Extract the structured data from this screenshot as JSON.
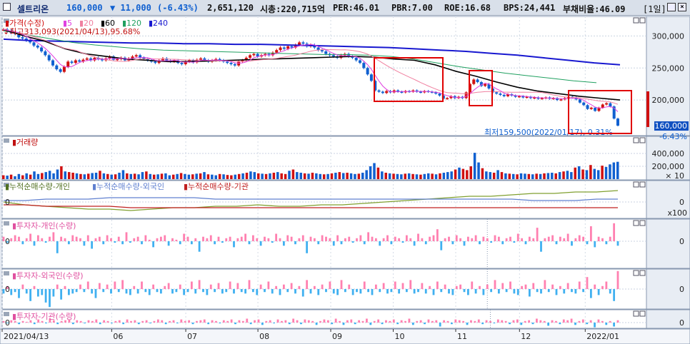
{
  "header": {
    "name": "셀트리온",
    "price": "160,000",
    "change": "▼ 11,000",
    "change_pct": "(-6.43%)",
    "volume": "2,651,120",
    "market_cap": "시총:220,715억",
    "per": "PER:46.01",
    "pbr": "PBR:7.00",
    "roe": "ROE:16.68",
    "bps": "BPS:24,441",
    "debt": "부채비율:46.09",
    "period": "[1일]"
  },
  "colors": {
    "up": "#d01010",
    "down": "#1060d0",
    "ma5": "#e040e0",
    "ma20": "#f080a0",
    "ma60": "#000000",
    "ma120": "#20a060",
    "ma240": "#1818d0",
    "inv_personal": "#80a030",
    "inv_foreign": "#6080d0",
    "inv_inst": "#c02020",
    "bar_pos": "#ff80b0",
    "bar_neg": "#40b0f0",
    "highlight": "#e00000"
  },
  "chart_data": [
    {
      "type": "line",
      "panel": "price",
      "legend_prefix": "가격(수정)",
      "legend": [
        "5",
        "20",
        "60",
        "120",
        "240"
      ],
      "annotation_high": "최고313,093(2021/04/13),95.68%",
      "annotation_low": "최저159,500(2022/01/17), 0.31%",
      "current_price": 160000,
      "current_price_label": "160,000",
      "current_change_label": "-6.43%",
      "x_ticks": [
        "2021/04/13",
        "06",
        "07",
        "08",
        "09",
        "10",
        "11",
        "12",
        "2022/01"
      ],
      "y_ticks": [
        300000,
        250000,
        200000
      ],
      "y_tick_labels": [
        "300,000",
        "250,000",
        "200,000"
      ],
      "ylim": [
        150000,
        325000
      ],
      "close": [
        310000,
        308000,
        305000,
        304000,
        298000,
        296000,
        293000,
        290000,
        285000,
        282000,
        276000,
        270000,
        262000,
        254000,
        248000,
        244000,
        252000,
        260000,
        258000,
        262000,
        260000,
        263000,
        265000,
        262000,
        266000,
        264000,
        262000,
        265000,
        268000,
        263000,
        264000,
        266000,
        262000,
        265000,
        268000,
        270000,
        266000,
        264000,
        262000,
        260000,
        258000,
        262000,
        265000,
        262000,
        260000,
        262000,
        258000,
        256000,
        260000,
        262000,
        259000,
        263000,
        265000,
        262000,
        260000,
        262000,
        264000,
        262000,
        260000,
        258000,
        256000,
        254000,
        260000,
        262000,
        266000,
        270000,
        272000,
        268000,
        270000,
        272000,
        270000,
        274000,
        278000,
        282000,
        280000,
        284000,
        282000,
        286000,
        290000,
        288000,
        284000,
        286000,
        282000,
        278000,
        276000,
        272000,
        270000,
        268000,
        266000,
        270000,
        272000,
        268000,
        266000,
        262000,
        258000,
        250000,
        240000,
        230000,
        215000,
        213000,
        211000,
        214000,
        212000,
        215000,
        213000,
        212000,
        214000,
        213000,
        215000,
        213000,
        212000,
        214000,
        213000,
        212000,
        210000,
        207000,
        202000,
        203000,
        206000,
        203000,
        205000,
        203000,
        212000,
        225000,
        232000,
        228000,
        222000,
        225000,
        218000,
        212000,
        210000,
        208000,
        206000,
        209000,
        207000,
        205000,
        206000,
        204000,
        205000,
        203000,
        204000,
        202000,
        203000,
        204000,
        202000,
        203000,
        200000,
        201000,
        203000,
        205000,
        204000,
        201000,
        196000,
        192000,
        186000,
        188000,
        183000,
        188000,
        193000,
        195000,
        190000,
        171000,
        160000
      ],
      "ma60": [
        310000,
        300000,
        292000,
        280000,
        272000,
        268000,
        264000,
        262000,
        260000,
        260000,
        261000,
        262000,
        263000,
        264000,
        265000,
        266000,
        267000,
        268000,
        267000,
        264000,
        262000,
        255000,
        245000,
        237000,
        228000,
        220000,
        214000,
        210000,
        206000,
        203000,
        200000
      ],
      "ma120": [
        308000,
        302000,
        296000,
        290000,
        286000,
        283000,
        280000,
        278000,
        277000,
        276000,
        275000,
        274000,
        273000,
        272000,
        271000,
        271000,
        270000,
        268000,
        264000,
        258000,
        252000,
        247000,
        242000,
        238000,
        234000,
        230000,
        227000
      ],
      "ma240": [
        295000,
        293000,
        292000,
        291000,
        290000,
        289000,
        289000,
        288000,
        288000,
        287000,
        287000,
        286000,
        285000,
        284000,
        283000,
        282000,
        280000,
        278000,
        276000,
        273000,
        270000,
        266000,
        262000,
        258000,
        255000
      ]
    },
    {
      "type": "bar",
      "panel": "volume",
      "title": "거래량",
      "y_ticks": [
        400000,
        200000
      ],
      "y_tick_labels": [
        "400,000",
        "200,000"
      ],
      "unit_label": "× 10",
      "ylim": [
        0,
        500000
      ],
      "values": [
        60,
        55,
        70,
        45,
        80,
        60,
        90,
        70,
        120,
        80,
        95,
        110,
        130,
        90,
        150,
        200,
        120,
        110,
        100,
        90,
        80,
        75,
        85,
        95,
        100,
        130,
        90,
        80,
        70,
        75,
        100,
        140,
        90,
        80,
        85,
        75,
        110,
        120,
        80,
        70,
        75,
        85,
        90,
        60,
        70,
        80,
        95,
        80,
        70,
        75,
        85,
        90,
        110,
        75,
        70,
        60,
        80,
        75,
        65,
        60,
        70,
        80,
        90,
        100,
        120,
        110,
        90,
        85,
        80,
        90,
        100,
        110,
        90,
        80,
        130,
        150,
        110,
        100,
        90,
        85,
        100,
        90,
        80,
        75,
        80,
        90,
        100,
        110,
        95,
        100,
        90,
        80,
        85,
        100,
        140,
        200,
        250,
        180,
        120,
        100,
        90,
        85,
        80,
        75,
        85,
        90,
        80,
        75,
        70,
        80,
        90,
        85,
        75,
        90,
        100,
        110,
        120,
        150,
        180,
        160,
        140,
        200,
        410,
        260,
        170,
        120,
        110,
        100,
        140,
        110,
        90,
        85,
        80,
        75,
        90,
        85,
        80,
        75,
        85,
        80,
        90,
        95,
        100,
        90,
        110,
        120,
        130,
        110,
        180,
        200,
        150,
        140,
        220,
        160,
        140,
        210,
        190,
        230,
        260,
        270
      ],
      "directions": "UDUDDUDUDDUDDDDUDUUDUDUDDUDUDUDDUDUDDUDUDUDDUDUDDUDUDUDDUDUUDUDUDDUDUDUDUUDUDDUDUDDUDUDUDUDDUDDDDUDUDUDDUDUDUDDUDUDDDUDUUUDDUDDUDUDUDUDDUDUDUDDUDUDDUDUDUDDUDDD"
    },
    {
      "type": "line",
      "panel": "cumulative_net_buying",
      "series": [
        {
          "name": "누적순매수량-개인",
          "values": [
            0,
            -2,
            -3,
            -4,
            -5,
            -5,
            -6,
            -5,
            -4,
            -4,
            -3,
            -3,
            -2,
            -3,
            -3,
            -2,
            -2,
            -1,
            0,
            1,
            2,
            3,
            4,
            4,
            5,
            6,
            6,
            7,
            7,
            8
          ]
        },
        {
          "name": "누적순매수량-외국인",
          "values": [
            1,
            1,
            2,
            2,
            2,
            3,
            3,
            3,
            3,
            3,
            2,
            2,
            2,
            2,
            2,
            2,
            2,
            2,
            2,
            2,
            2,
            2,
            2,
            2,
            2,
            1,
            1,
            1,
            2,
            2
          ]
        },
        {
          "name": "누적순매수량-기관",
          "values": [
            -2,
            -2,
            -3,
            -3,
            -3,
            -3,
            -4,
            -4,
            -4,
            -4,
            -4,
            -4,
            -4,
            -4,
            -4,
            -4,
            -4,
            -4,
            -4,
            -4,
            -4,
            -4,
            -4,
            -4,
            -4,
            -4,
            -4,
            -4,
            -4,
            -4
          ]
        }
      ],
      "y_tick_labels": [
        "0"
      ],
      "unit_label": "x100"
    },
    {
      "type": "bar",
      "panel": "investor_personal",
      "title": "투자자-개인(수량)",
      "y_tick_labels": [
        "0"
      ],
      "values": [
        3,
        -1,
        2,
        4,
        3,
        -2,
        2,
        5,
        -3,
        4,
        2,
        -1,
        3,
        6,
        -8,
        3,
        2,
        -2,
        4,
        3,
        2,
        -3,
        4,
        -5,
        2,
        3,
        -2,
        4,
        2,
        -1,
        3,
        -2,
        6,
        -1,
        2,
        3,
        -2,
        4,
        1,
        -4,
        2,
        3,
        4,
        -3,
        2,
        1,
        -2,
        5,
        3,
        -2,
        2,
        -7,
        3,
        2,
        4,
        -2,
        3,
        -1,
        2,
        3,
        -4,
        2,
        3,
        5,
        -2,
        4,
        2,
        -3,
        3,
        2,
        -1,
        5,
        2,
        -3,
        4,
        3,
        -2,
        2,
        4,
        -8,
        3,
        2,
        -2,
        4,
        3,
        2,
        -3,
        4,
        -2,
        2,
        3,
        -1,
        2,
        4,
        -2,
        6,
        3,
        2,
        -3,
        2,
        4,
        -2,
        3,
        2,
        -1,
        4,
        2,
        -3,
        5,
        2,
        -2,
        3,
        4,
        8,
        -6,
        2,
        3,
        -2,
        4,
        2,
        -3,
        3,
        2,
        4,
        -2,
        3,
        2,
        -1,
        4,
        3,
        -2,
        2,
        3,
        -1,
        5,
        2,
        -2,
        3,
        2,
        9,
        -7,
        2,
        3,
        4,
        -2,
        3,
        2,
        5,
        -3,
        2,
        4,
        3,
        -2,
        10,
        -4,
        3,
        2,
        -2,
        3,
        12,
        -3
      ],
      "marker_index": 126
    },
    {
      "type": "bar",
      "panel": "investor_foreign",
      "title": "투자자-외국인(수량)",
      "y_tick_labels": [
        "0"
      ],
      "values": [
        -3,
        2,
        -4,
        -2,
        -6,
        3,
        -3,
        -8,
        2,
        -5,
        -4,
        -9,
        -12,
        -5,
        3,
        -7,
        2,
        -4,
        -3,
        -2,
        3,
        -2,
        5,
        -3,
        -6,
        4,
        -2,
        3,
        -3,
        5,
        -2,
        6,
        -3,
        -4,
        2,
        -3,
        5,
        -2,
        -4,
        3,
        -2,
        -3,
        2,
        4,
        -3,
        -2,
        3,
        -4,
        -2,
        5,
        -3,
        6,
        -2,
        -4,
        3,
        -2,
        4,
        -3,
        -2,
        5,
        -3,
        4,
        -2,
        -3,
        6,
        -2,
        -4,
        3,
        -2,
        5,
        -3,
        2,
        -4,
        3,
        -2,
        4,
        -3,
        2,
        -5,
        6,
        -3,
        2,
        -4,
        3,
        -2,
        5,
        -3,
        -4,
        6,
        -2,
        3,
        -4,
        -2,
        -3,
        5,
        -2,
        -4,
        3,
        -2,
        4,
        -3,
        -2,
        5,
        -3,
        4,
        -2,
        6,
        -3,
        -2,
        4,
        -3,
        2,
        -4,
        5,
        -2,
        3,
        -3,
        -4,
        2,
        3,
        -2,
        -4,
        5,
        -3,
        2,
        -4,
        3,
        -2,
        6,
        -3,
        4,
        -2,
        5,
        -3,
        -4,
        2,
        3,
        -5,
        4,
        -2,
        -3,
        6,
        -2,
        3,
        -4,
        2,
        -3,
        4,
        -2,
        -3,
        5,
        -2,
        8,
        -6,
        3,
        -4,
        2,
        5,
        -3,
        -8,
        12
      ],
      "marker_index": 126
    },
    {
      "type": "bar",
      "panel": "investor_institution",
      "title": "투자자-기관(수량)",
      "y_tick_labels": [
        "0"
      ],
      "values": [
        2,
        -1,
        3,
        2,
        -2,
        2,
        1,
        3,
        -2,
        4,
        2,
        -1,
        5,
        3,
        -2,
        2,
        3,
        4,
        -2,
        3,
        2,
        -1,
        3,
        2,
        4,
        -2,
        3,
        2,
        -1,
        2,
        3,
        -2,
        4,
        2,
        3,
        -2,
        2,
        3,
        -1,
        2,
        4,
        3,
        -2,
        2,
        3,
        -1,
        4,
        2,
        3,
        -2,
        2,
        3,
        4,
        -2,
        3,
        2,
        -1,
        3,
        2,
        4,
        -2,
        3,
        2,
        5,
        -2,
        3,
        4,
        -3,
        2,
        3,
        -1,
        4,
        2,
        3,
        -2,
        5,
        3,
        -2,
        4,
        3,
        2,
        -3,
        2,
        4,
        3,
        -2,
        5,
        2,
        -3,
        3,
        4,
        -2,
        3,
        2,
        5,
        -3,
        2,
        4,
        -2,
        3,
        2,
        4,
        -2,
        3,
        2,
        5,
        -3,
        2,
        3,
        -2,
        4,
        2,
        3,
        -5,
        3,
        2,
        -2,
        4,
        3,
        2,
        -3,
        3,
        2,
        4,
        -2,
        3,
        2,
        -1,
        4,
        3,
        2,
        -2,
        3,
        4,
        -3,
        2,
        3,
        -2,
        5,
        3,
        2,
        -4,
        3,
        2,
        -2,
        4,
        3,
        5,
        -3,
        2,
        4,
        -2,
        3,
        -6,
        4,
        2,
        -3,
        2,
        -5,
        3
      ],
      "marker_index": 126
    }
  ]
}
